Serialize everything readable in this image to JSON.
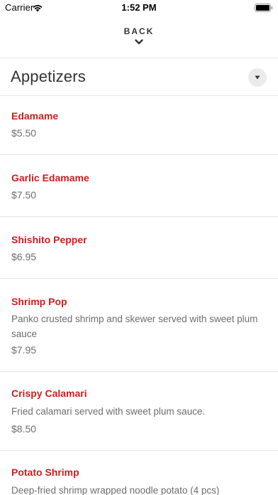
{
  "status_bar": {
    "carrier": "Carrier",
    "time": "1:52 PM"
  },
  "nav": {
    "back_label": "BACK"
  },
  "section": {
    "title": "Appetizers"
  },
  "items": [
    {
      "name": "Edamame",
      "description": "",
      "price": "$5.50"
    },
    {
      "name": "Garlic Edamame",
      "description": "",
      "price": "$7.50"
    },
    {
      "name": "Shishito Pepper",
      "description": "",
      "price": "$6.95"
    },
    {
      "name": "Shrimp Pop",
      "description": "Panko crusted shrimp and skewer served with sweet plum sauce",
      "price": "$7.95"
    },
    {
      "name": "Crispy Calamari",
      "description": "Fried calamari served with sweet plum sauce.",
      "price": "$8.50"
    },
    {
      "name": "Potato Shrimp",
      "description": "Deep-fried shrimp wrapped noodle potato (4 pcs)",
      "price": ""
    }
  ],
  "colors": {
    "item_name": "#cc1e1e",
    "text_muted": "#6e6e6e",
    "divider": "#e6e6e6"
  }
}
